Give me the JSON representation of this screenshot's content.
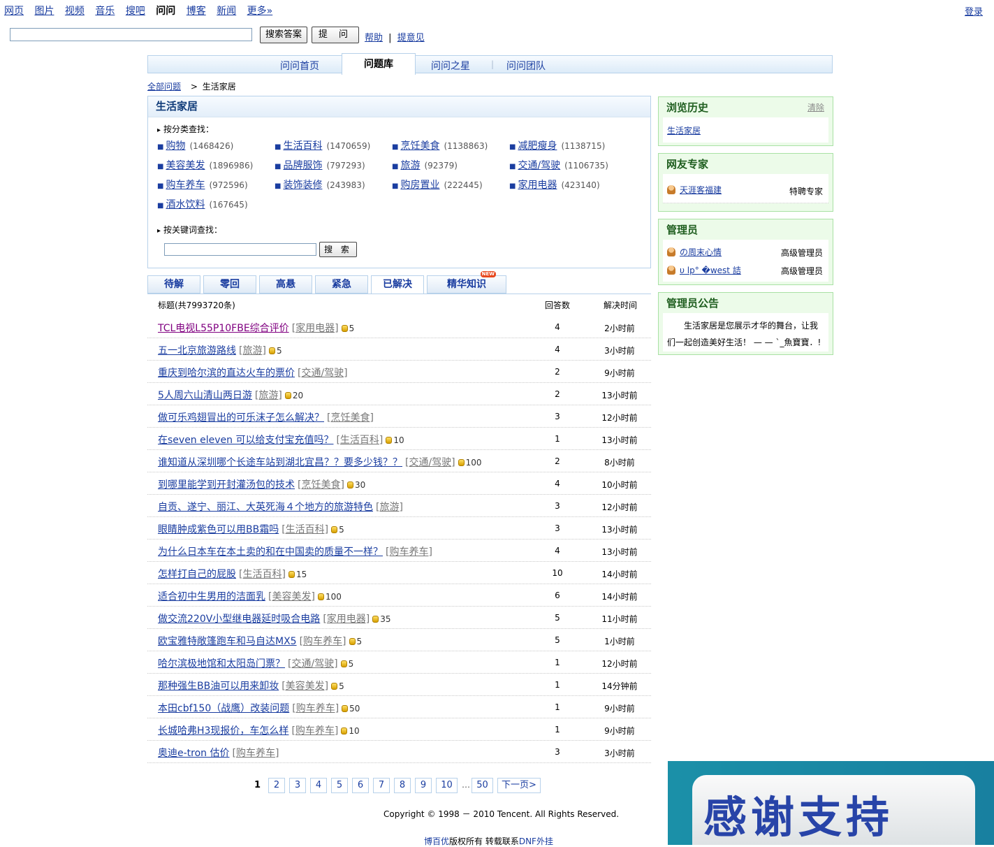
{
  "topnav": {
    "items": [
      "网页",
      "图片",
      "视频",
      "音乐",
      "搜吧",
      "问问",
      "博客",
      "新闻",
      "更多»"
    ],
    "login": "登录"
  },
  "search": {
    "button": "搜索答案",
    "ask": "提 问",
    "help": "帮助",
    "sep": "|",
    "feedback": "提意见"
  },
  "tabs": [
    "问问首页",
    "问题库",
    "问问之星",
    "问问团队"
  ],
  "breadcrumb": {
    "root": "全部问题",
    "arrow": ">",
    "current": "生活家居"
  },
  "catpanel": {
    "title": "生活家居",
    "by_category": "按分类查找：",
    "by_keyword": "按关键词查找：",
    "kw_button": "搜 索",
    "categories": [
      {
        "name": "购物",
        "count": "(1468426)"
      },
      {
        "name": "生活百科",
        "count": "(1470659)"
      },
      {
        "name": "烹饪美食",
        "count": "(1138863)"
      },
      {
        "name": "减肥瘦身",
        "count": "(1138715)"
      },
      {
        "name": "美容美发",
        "count": "(1896986)"
      },
      {
        "name": "品牌服饰",
        "count": "(797293)"
      },
      {
        "name": "旅游",
        "count": "(92379)"
      },
      {
        "name": "交通/驾驶",
        "count": "(1106735)"
      },
      {
        "name": "购车养车",
        "count": "(972596)"
      },
      {
        "name": "装饰装修",
        "count": "(243983)"
      },
      {
        "name": "购房置业",
        "count": "(222445)"
      },
      {
        "name": "家用电器",
        "count": "(423140)"
      },
      {
        "name": "酒水饮料",
        "count": "(167645)"
      }
    ]
  },
  "qtabs": [
    "待解",
    "零回",
    "高悬",
    "紧急",
    "已解决",
    "精华知识"
  ],
  "qtab_new": "NEW",
  "table": {
    "col_title": "标题(共7993720条)",
    "col_answers": "回答数",
    "col_time": "解决时间",
    "rows": [
      {
        "title": "TCL电视L55P10FBE综合评价",
        "tag": "[家用电器]",
        "reward": "5",
        "answers": "4",
        "time": "2小时前"
      },
      {
        "title": "五一北京旅游路线",
        "tag": "[旅游]",
        "reward": "5",
        "answers": "4",
        "time": "3小时前"
      },
      {
        "title": "重庆到哈尔滨的直达火车的票价",
        "tag": "[交通/驾驶]",
        "reward": "",
        "answers": "2",
        "time": "9小时前"
      },
      {
        "title": "5人周六山清山两日游",
        "tag": "[旅游]",
        "reward": "20",
        "answers": "2",
        "time": "13小时前"
      },
      {
        "title": "做可乐鸡翅冒出的可乐沫子怎么解决？",
        "tag": "[烹饪美食]",
        "reward": "",
        "answers": "3",
        "time": "12小时前"
      },
      {
        "title": "在seven eleven 可以给支付宝充值吗？",
        "tag": "[生活百科]",
        "reward": "10",
        "answers": "1",
        "time": "13小时前"
      },
      {
        "title": "谁知道从深圳哪个长途车站到湖北宜昌？？要多少钱？？",
        "tag": "[交通/驾驶]",
        "reward": "100",
        "answers": "2",
        "time": "8小时前"
      },
      {
        "title": "到哪里能学到开封灌汤包的技术",
        "tag": "[烹饪美食]",
        "reward": "30",
        "answers": "4",
        "time": "10小时前"
      },
      {
        "title": "自贡、遂宁、丽江、大英死海４个地方的旅游特色",
        "tag": "[旅游]",
        "reward": "",
        "answers": "3",
        "time": "12小时前"
      },
      {
        "title": "眼睛肿成紫色可以用BB霜吗",
        "tag": "[生活百科]",
        "reward": "5",
        "answers": "3",
        "time": "13小时前"
      },
      {
        "title": "为什么日本车在本土卖的和在中国卖的质量不一样？",
        "tag": "[购车养车]",
        "reward": "",
        "answers": "4",
        "time": "13小时前"
      },
      {
        "title": "怎样打自己的屁股",
        "tag": "[生活百科]",
        "reward": "15",
        "answers": "10",
        "time": "14小时前"
      },
      {
        "title": "适合初中生男用的洁面乳",
        "tag": "[美容美发]",
        "reward": "100",
        "answers": "6",
        "time": "14小时前"
      },
      {
        "title": "做交流220V小型继电器延时吸合电路",
        "tag": "[家用电器]",
        "reward": "35",
        "answers": "5",
        "time": "11小时前"
      },
      {
        "title": "欧宝雅特敞篷跑车和马自达MX5",
        "tag": "[购车养车]",
        "reward": "5",
        "answers": "5",
        "time": "1小时前"
      },
      {
        "title": "哈尔滨极地馆和太阳岛门票？",
        "tag": "[交通/驾驶]",
        "reward": "5",
        "answers": "1",
        "time": "12小时前"
      },
      {
        "title": "那种强生BB油可以用来卸妆",
        "tag": "[美容美发]",
        "reward": "5",
        "answers": "1",
        "time": "14分钟前"
      },
      {
        "title": "本田cbf150（战鹰）改装问题",
        "tag": "[购车养车]",
        "reward": "50",
        "answers": "1",
        "time": "9小时前"
      },
      {
        "title": "长城哈弗H3现报价，车怎么样",
        "tag": "[购车养车]",
        "reward": "10",
        "answers": "1",
        "time": "9小时前"
      },
      {
        "title": "奥迪e-tron 估价",
        "tag": "[购车养车]",
        "reward": "",
        "answers": "3",
        "time": "3小时前"
      }
    ]
  },
  "pagination": {
    "current": "1",
    "pages": [
      "2",
      "3",
      "4",
      "5",
      "6",
      "7",
      "8",
      "9",
      "10"
    ],
    "ellipsis": "…",
    "last": "50",
    "next": "下一页>"
  },
  "footer": {
    "copyright": "Copyright © 1998 － 2010 Tencent. All Rights Reserved.",
    "brand": "博百优",
    "rights": "版权所有 转载联系",
    "dnf": "DNF外挂"
  },
  "sidebar": {
    "history": {
      "title": "浏览历史",
      "clear": "清除",
      "item": "生活家居"
    },
    "experts": {
      "title": "网友专家",
      "name": "天涯客福建",
      "role": "特聘专家"
    },
    "admins": {
      "title": "管理员",
      "list": [
        {
          "name": "の周末心情",
          "role": "高级管理员"
        },
        {
          "name": "υ lp° �west 詰",
          "role": "高级管理员"
        }
      ]
    },
    "notice": {
      "title": "管理员公告",
      "text1": "生活家居是您展示才华的舞台，让我",
      "text2": "们一起创造美好生活！ — — `_魚寶寶．!"
    }
  },
  "banner": {
    "text": "感谢支持"
  },
  "colors": {
    "link": "#1a3da0",
    "panel_border": "#b7d1ea",
    "side_border": "#a9e1a4",
    "side_bg": "#ecfbe9",
    "banner": "#1b90a8"
  }
}
